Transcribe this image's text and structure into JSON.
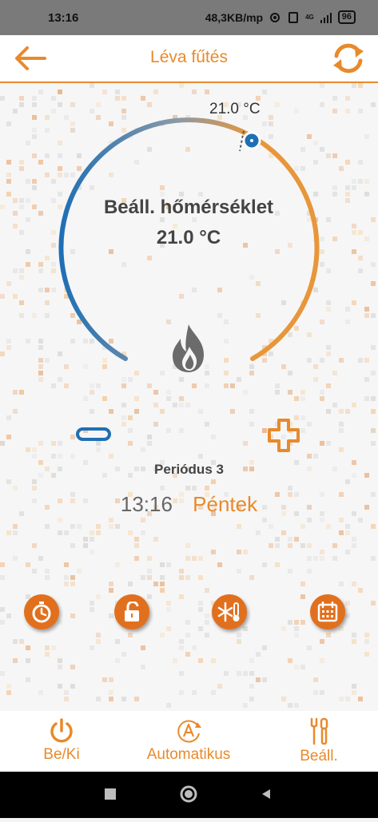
{
  "status_bar": {
    "time": "13:16",
    "net_speed": "48,3KB/mp",
    "network_badge": "4G",
    "battery": "96"
  },
  "app_bar": {
    "title": "Léva fűtés",
    "back_icon": "arrow-left-icon",
    "refresh_icon": "refresh-icon"
  },
  "thermostat": {
    "setpoint_marker_label": "21.0 °C",
    "set_label": "Beáll. hőmérséklet",
    "set_value": "21.0 °C",
    "heating_icon": "flame-icon",
    "minus_icon": "minus-icon",
    "plus_icon": "plus-icon"
  },
  "schedule": {
    "period": "Periódus 3",
    "time": "13:16",
    "day": "Péntek"
  },
  "quick_actions": [
    {
      "icon": "stopwatch-icon"
    },
    {
      "icon": "unlock-icon"
    },
    {
      "icon": "snowflake-thermometer-icon"
    },
    {
      "icon": "calendar-icon"
    }
  ],
  "bottom_nav": {
    "power": {
      "label": "Be/Ki",
      "icon": "power-icon"
    },
    "auto": {
      "label": "Automatikus",
      "icon": "auto-mode-icon"
    },
    "settings": {
      "label": "Beáll.",
      "icon": "tools-icon"
    }
  },
  "colors": {
    "accent": "#e88a2c",
    "cold": "#1f6fb5",
    "button_fill": "#e1701e"
  }
}
